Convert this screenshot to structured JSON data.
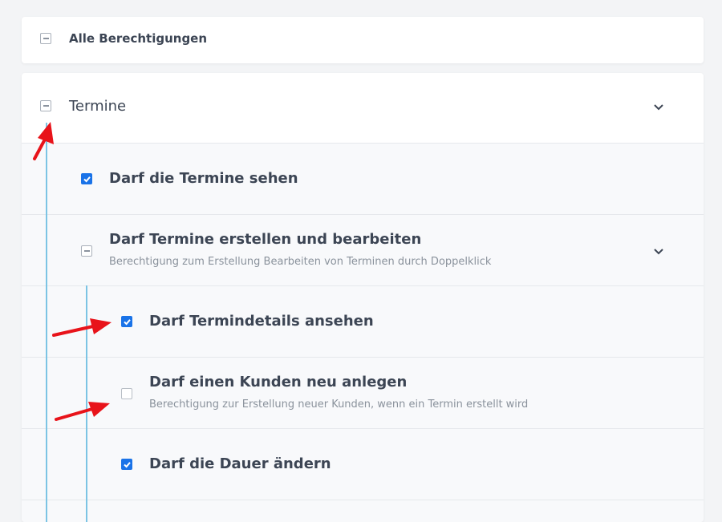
{
  "all_permissions": {
    "label": "Alle Berechtigungen"
  },
  "termine": {
    "label": "Termine",
    "items": [
      {
        "label": "Darf die Termine sehen",
        "checked": true
      },
      {
        "label": "Darf Termine erstellen und bearbeiten",
        "description": "Berechtigung zum Erstellung Bearbeiten von Terminen durch Doppelklick",
        "children": [
          {
            "label": "Darf Termindetails ansehen",
            "checked": true
          },
          {
            "label": "Darf einen Kunden neu anlegen",
            "description": "Berechtigung zur Erstellung neuer Kunden, wenn ein Termin erstellt wird",
            "checked": false
          },
          {
            "label": "Darf die Dauer ändern",
            "checked": true
          }
        ]
      }
    ]
  },
  "colors": {
    "accent": "#1a73e8",
    "tree_line": "#7cc4e4",
    "annotation_arrow": "#e8131a"
  }
}
